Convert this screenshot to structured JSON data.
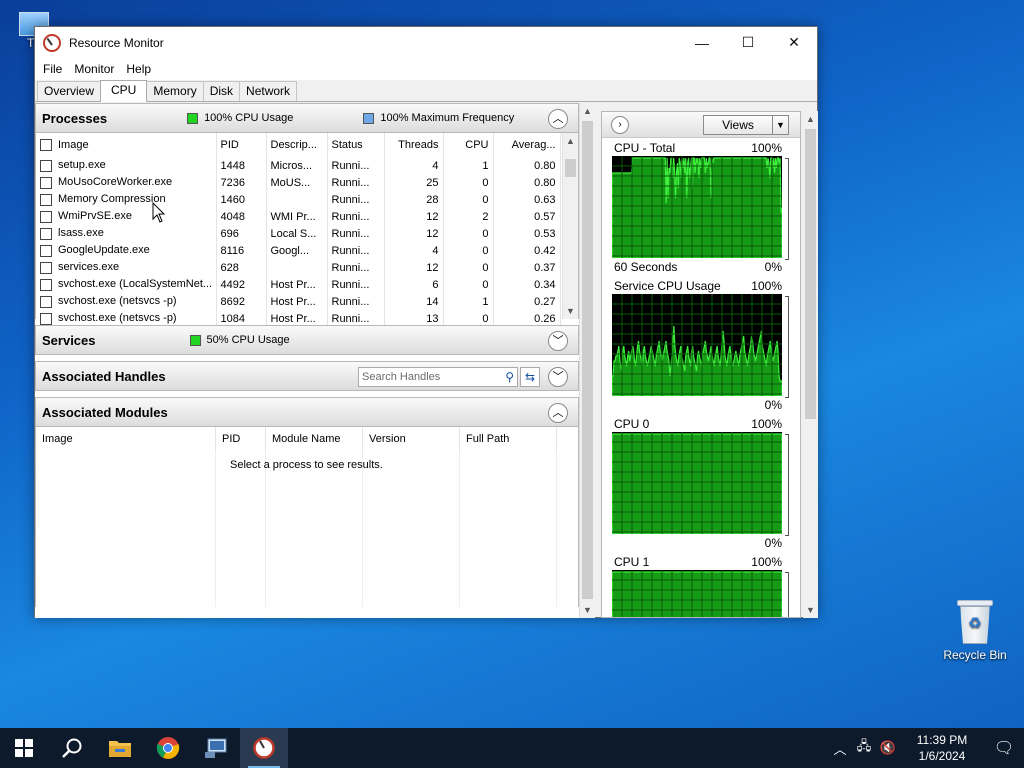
{
  "desktop": {
    "this_pc_label": "Th",
    "recycle_bin_label": "Recycle Bin"
  },
  "window": {
    "title": "Resource Monitor",
    "controls": {
      "minimize": "—",
      "maximize": "☐",
      "close": "✕"
    }
  },
  "menu": [
    "File",
    "Monitor",
    "Help"
  ],
  "tabs": [
    {
      "label": "Overview",
      "active": false
    },
    {
      "label": "CPU",
      "active": true
    },
    {
      "label": "Memory",
      "active": false
    },
    {
      "label": "Disk",
      "active": false
    },
    {
      "label": "Network",
      "active": false
    }
  ],
  "processes": {
    "title": "Processes",
    "legend1": "100% CPU Usage",
    "legend1_color": "#22d422",
    "legend2": "100% Maximum Frequency",
    "legend2_color": "#6ea8e6",
    "columns": [
      "Image",
      "PID",
      "Descrip...",
      "Status",
      "Threads",
      "CPU",
      "Averag..."
    ],
    "rows": [
      [
        "setup.exe",
        "1448",
        "Micros...",
        "Runni...",
        "4",
        "1",
        "0.80"
      ],
      [
        "MoUsoCoreWorker.exe",
        "7236",
        "MoUS...",
        "Runni...",
        "25",
        "0",
        "0.80"
      ],
      [
        "Memory Compression",
        "1460",
        "",
        "Runni...",
        "28",
        "0",
        "0.63"
      ],
      [
        "WmiPrvSE.exe",
        "4048",
        "WMI Pr...",
        "Runni...",
        "12",
        "2",
        "0.57"
      ],
      [
        "lsass.exe",
        "696",
        "Local S...",
        "Runni...",
        "12",
        "0",
        "0.53"
      ],
      [
        "GoogleUpdate.exe",
        "8116",
        "Googl...",
        "Runni...",
        "4",
        "0",
        "0.42"
      ],
      [
        "services.exe",
        "628",
        "",
        "Runni...",
        "12",
        "0",
        "0.37"
      ],
      [
        "svchost.exe (LocalSystemNet...",
        "4492",
        "Host Pr...",
        "Runni...",
        "6",
        "0",
        "0.34"
      ],
      [
        "svchost.exe (netsvcs -p)",
        "8692",
        "Host Pr...",
        "Runni...",
        "14",
        "1",
        "0.27"
      ],
      [
        "svchost.exe (netsvcs -p)",
        "1084",
        "Host Pr...",
        "Runni...",
        "13",
        "0",
        "0.26"
      ]
    ]
  },
  "services": {
    "title": "Services",
    "legend": "50% CPU Usage",
    "legend_color": "#22d422"
  },
  "handles": {
    "title": "Associated Handles",
    "search_placeholder": "Search Handles"
  },
  "modules": {
    "title": "Associated Modules",
    "columns": [
      "Image",
      "PID",
      "Module Name",
      "Version",
      "Full Path"
    ],
    "empty_message": "Select a process to see results."
  },
  "right_panel": {
    "views_label": "Views",
    "graphs": [
      {
        "label": "CPU - Total",
        "max": "100%",
        "min": "0%",
        "footer": "60 Seconds",
        "values": [
          85,
          85,
          85,
          85,
          85,
          85,
          85,
          85,
          85,
          85,
          85,
          85,
          85,
          85,
          85,
          85,
          85,
          85,
          85,
          85,
          85,
          85,
          100,
          100,
          100,
          100,
          100,
          100,
          100,
          100,
          100,
          100,
          100,
          100,
          100,
          100,
          100,
          100,
          100,
          100,
          100,
          100,
          100,
          100,
          100,
          100,
          100,
          100,
          100,
          100,
          100,
          100,
          100,
          100,
          100,
          100,
          100,
          100,
          55,
          100,
          60,
          90,
          85,
          100,
          95,
          80,
          100,
          90,
          60,
          85,
          95,
          70,
          100,
          95,
          80,
          100,
          90,
          100,
          85,
          100,
          60,
          95,
          100,
          80,
          90,
          100,
          70,
          100,
          100,
          85,
          100,
          95,
          100,
          80,
          100,
          90,
          100,
          100,
          100,
          100,
          85,
          100,
          90,
          95,
          100,
          100,
          60,
          100,
          95,
          100,
          100,
          100,
          100,
          100,
          100,
          100,
          100,
          100,
          100,
          100,
          100,
          100,
          100,
          100,
          100,
          100,
          100,
          100,
          100,
          100,
          100,
          100,
          100,
          100,
          100,
          100,
          100,
          100,
          100,
          100,
          100,
          100,
          100,
          100,
          100,
          100,
          100,
          100,
          100,
          100,
          100,
          100,
          100,
          100,
          100,
          100,
          100,
          100,
          100,
          100,
          100,
          100,
          100,
          100,
          100,
          100,
          90,
          100,
          95,
          80,
          100,
          100,
          90,
          100,
          85,
          100,
          90,
          100,
          100,
          95,
          100,
          45,
          50
        ]
      },
      {
        "label": "Service CPU Usage",
        "max": "100%",
        "min": "0%",
        "footer": "",
        "values": [
          20,
          20,
          35,
          35,
          40,
          40,
          45,
          50,
          35,
          30,
          25,
          45,
          50,
          40,
          35,
          30,
          40,
          45,
          35,
          40,
          45,
          50,
          45,
          35,
          30,
          40,
          50,
          55,
          45,
          40,
          35,
          30,
          45,
          50,
          40,
          35,
          30,
          35,
          40,
          45,
          50,
          45,
          40,
          35,
          30,
          40,
          45,
          50,
          55,
          45,
          40,
          35,
          40,
          45,
          50,
          55,
          45,
          40,
          35,
          20,
          30,
          40,
          55,
          70,
          50,
          40,
          35,
          30,
          40,
          45,
          50,
          40,
          35,
          30,
          25,
          40,
          45,
          50,
          40,
          35,
          30,
          45,
          50,
          40,
          35,
          30,
          25,
          40,
          45,
          40,
          35,
          30,
          40,
          45,
          50,
          55,
          45,
          40,
          35,
          40,
          45,
          50,
          40,
          35,
          30,
          40,
          45,
          50,
          40,
          35,
          30,
          40,
          55,
          65,
          55,
          40,
          35,
          30,
          40,
          45,
          50,
          40,
          35,
          30,
          35,
          40,
          45,
          40,
          35,
          30,
          40,
          45,
          50,
          55,
          60,
          45,
          40,
          35,
          30,
          40,
          45,
          50,
          60,
          55,
          45,
          40,
          35,
          40,
          45,
          50,
          55,
          60,
          65,
          50,
          45,
          40,
          35,
          30,
          40,
          45,
          50,
          55,
          45,
          40,
          35,
          40,
          45,
          50,
          55,
          45,
          20,
          15,
          15,
          15
        ]
      },
      {
        "label": "CPU 0",
        "max": "100%",
        "min": "0%",
        "footer": "",
        "values": [
          100,
          100,
          100,
          100,
          100,
          100,
          100,
          100,
          100,
          100,
          100,
          100,
          100,
          100,
          100,
          100,
          100,
          100,
          100,
          100,
          100,
          100,
          100,
          100,
          100,
          100,
          100,
          100,
          100,
          100,
          100,
          100,
          100,
          100,
          100,
          100,
          100,
          100,
          100,
          100,
          100,
          100,
          100,
          100,
          100,
          100,
          100,
          100,
          100,
          100,
          100,
          100,
          100,
          100,
          100,
          100,
          100,
          100,
          100,
          100,
          100,
          100,
          100,
          100,
          100,
          100,
          100,
          100,
          100,
          100,
          100,
          100,
          100,
          100,
          100,
          100,
          100,
          100,
          100,
          100,
          100,
          100,
          100,
          100,
          100,
          100,
          100,
          100,
          100,
          100,
          100,
          100,
          100,
          100,
          100,
          100,
          100,
          100,
          100,
          100,
          100,
          100,
          100,
          100,
          100,
          100,
          100,
          100,
          100,
          100,
          100,
          100,
          100,
          100,
          100,
          100,
          100,
          100,
          100,
          100,
          100,
          100,
          100,
          100,
          100,
          100,
          100,
          100,
          100,
          100,
          100,
          100,
          100,
          100,
          100,
          100,
          100,
          100,
          100,
          100,
          100,
          100,
          100,
          100,
          100,
          100,
          100,
          100,
          100,
          100,
          100,
          100,
          100,
          100,
          100,
          100,
          100,
          100,
          100,
          100,
          100,
          100,
          100,
          100,
          100,
          100,
          100,
          100,
          100,
          100
        ]
      },
      {
        "label": "CPU 1",
        "max": "100%",
        "min": "",
        "footer": "",
        "values": [
          100,
          100,
          100,
          100,
          100,
          100,
          100,
          100,
          100,
          100,
          100,
          100,
          100,
          100,
          100,
          100,
          100,
          100,
          100,
          100,
          100,
          100,
          100,
          100,
          100,
          100,
          100,
          100,
          100,
          100,
          100,
          100,
          100,
          100,
          100,
          100,
          100,
          100,
          100,
          100,
          100,
          100,
          100,
          100,
          100,
          100,
          100,
          100,
          100,
          100,
          100,
          100,
          100,
          100,
          100,
          100,
          100,
          100,
          100,
          100,
          100,
          100,
          100,
          100,
          100,
          100,
          100,
          100,
          100,
          100,
          100,
          100,
          100,
          100,
          100,
          100,
          100,
          100,
          100,
          100,
          100,
          100,
          100,
          100,
          100,
          100,
          100,
          100,
          100,
          100,
          100,
          100,
          100,
          100,
          100,
          100,
          100,
          100,
          100,
          100,
          100,
          100,
          100,
          100,
          100,
          100,
          100,
          100,
          100,
          100,
          100,
          100,
          100,
          100,
          100,
          100,
          100,
          100,
          100,
          100,
          100,
          100,
          100,
          100,
          100,
          100,
          100,
          100,
          100,
          100,
          100,
          100,
          100,
          100,
          100,
          100,
          100,
          100,
          100,
          100,
          100,
          100,
          100,
          100,
          100,
          100,
          100,
          100,
          100,
          100,
          100,
          100,
          100,
          100,
          100,
          100,
          100,
          100,
          100,
          100,
          100,
          100,
          100,
          100,
          100,
          100,
          100,
          100,
          100,
          100
        ]
      }
    ]
  },
  "taskbar": {
    "items": [
      "start",
      "search",
      "file-explorer",
      "chrome",
      "network-app",
      "resource-monitor"
    ],
    "time": "11:39 PM",
    "date": "1/6/2024"
  }
}
